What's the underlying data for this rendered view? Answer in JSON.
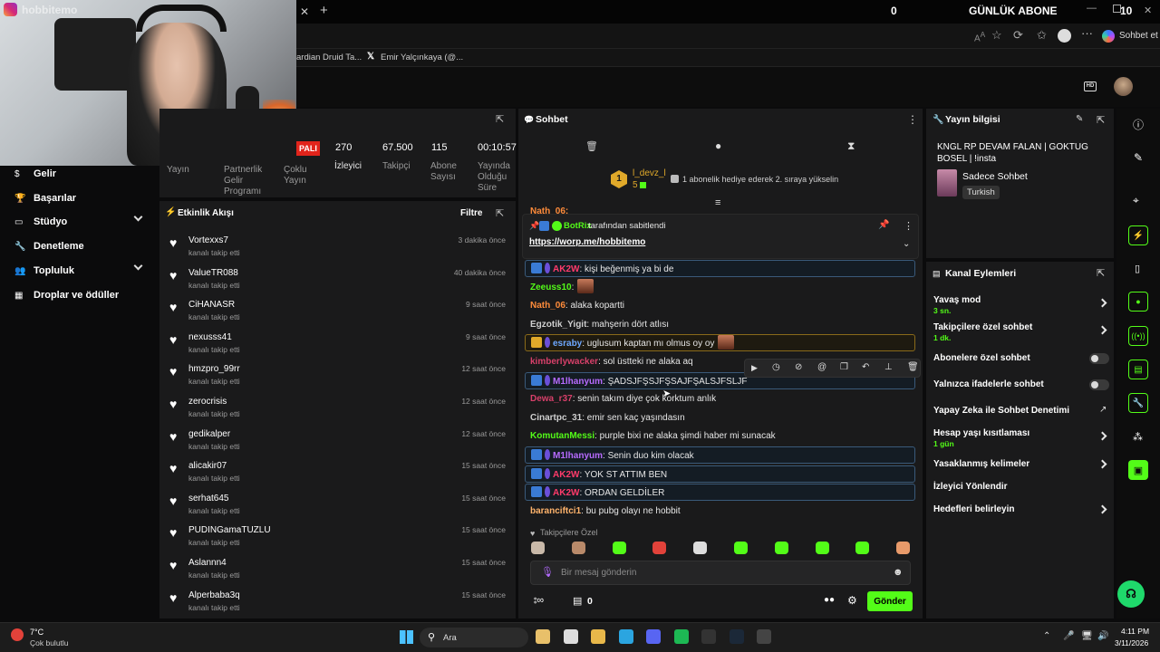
{
  "browser": {
    "webcam_overlay_text": "hobbitemo",
    "counter_left": "0",
    "daily_label": "GÜNLÜK ABONE",
    "counter_right": "10",
    "bookmark_1": "ardian Druid Ta...",
    "bookmark_2": "Emir Yalçınkaya (@...",
    "sohbet_et": "Sohbet et"
  },
  "stats": {
    "live_badge": "PALI",
    "viewers_value": "270",
    "viewers_label": "İzleyici",
    "followers_value": "67.500",
    "followers_label": "Takipçi",
    "subs_value": "115",
    "subs_label": "Abone Sayısı",
    "duration_value": "00:10:57",
    "duration_label": "Yayında Olduğu Süre",
    "col1": "Yayın",
    "col2": "Partnerlik Gelir Programı",
    "col3": "Çoklu Yayın"
  },
  "sidebar": {
    "items": [
      {
        "label": "Gelir",
        "chevron": false
      },
      {
        "label": "Başarılar",
        "chevron": false
      },
      {
        "label": "Stüdyo",
        "chevron": true
      },
      {
        "label": "Denetleme",
        "chevron": false
      },
      {
        "label": "Topluluk",
        "chevron": true
      },
      {
        "label": "Droplar ve ödüller",
        "chevron": false
      }
    ]
  },
  "activity": {
    "title": "Etkinlik Akışı",
    "filter": "Filtre",
    "action_text": "kanalı takip etti",
    "rows": [
      {
        "name": "Vortexxs7",
        "time": "3 dakika önce"
      },
      {
        "name": "ValueTR088",
        "time": "40 dakika önce"
      },
      {
        "name": "CiHANASR",
        "time": "9 saat önce"
      },
      {
        "name": "nexusss41",
        "time": "9 saat önce"
      },
      {
        "name": "hmzpro_99rr",
        "time": "12 saat önce"
      },
      {
        "name": "zerocrisis",
        "time": "12 saat önce"
      },
      {
        "name": "gedikalper",
        "time": "12 saat önce"
      },
      {
        "name": "alicakir07",
        "time": "15 saat önce"
      },
      {
        "name": "serhat645",
        "time": "15 saat önce"
      },
      {
        "name": "PUDINGamaTUZLU",
        "time": "15 saat önce"
      },
      {
        "name": "Aslannn4",
        "time": "15 saat önce"
      },
      {
        "name": "Alperbaba3q",
        "time": "15 saat önce"
      }
    ]
  },
  "chat": {
    "title": "Sohbet",
    "gift_user": "l_devz_l",
    "gift_level": "5",
    "gift_text": "1 abonelik hediye ederek 2. sıraya yükselin",
    "clipped_user": "Nath_06:",
    "pinned_by": "BotRix",
    "pinned_suffix": "tarafından sabitlendi",
    "pinned_link": "https://worp.me/hobbitemo",
    "messages": [
      {
        "user": "AK2W",
        "text": ": kişi beğenmiş ya bi de",
        "color": "#ff3b6b",
        "style": "boxed"
      },
      {
        "user": "Zeeuss10",
        "text": ":",
        "color": "#53fc18",
        "style": "plain"
      },
      {
        "user": "Nath_06",
        "text": ": alaka kopartti",
        "color": "#ff8c3b",
        "style": "plain"
      },
      {
        "user": "Egzotik_Yigit",
        "text": ": mahşerin dört atlısı",
        "color": "#cfcfcf",
        "style": "plain"
      },
      {
        "user": "esraby",
        "text": ": uglusum kaptan mı olmus oy oy",
        "color": "#6ea8ff",
        "style": "gold"
      },
      {
        "user": "kimberlywacker",
        "text": ": sol üstteki ne alaka aq",
        "color": "#d8406a",
        "style": "plain"
      },
      {
        "user": "M1lhanyum",
        "text": ": ŞADSJFŞSJFŞSAJFŞALSJFSLJF",
        "color": "#b76bff",
        "style": "boxed"
      },
      {
        "user": "Dewa_r37",
        "text": ": senin takım diye çok korktum anlık",
        "color": "#d8406a",
        "style": "plain"
      },
      {
        "user": "Cinartpc_31",
        "text": ": emir sen kaç yaşındasın",
        "color": "#cfcfcf",
        "style": "plain"
      },
      {
        "user": "KomutanMessi",
        "text": ": purple bixi ne alaka şimdi haber mi sunacak",
        "color": "#53fc18",
        "style": "plain"
      },
      {
        "user": "M1lhanyum",
        "text": ": Senin duo kim olacak",
        "color": "#b76bff",
        "style": "boxed"
      },
      {
        "user": "AK2W",
        "text": ": YOK ST ATTIM BEN",
        "color": "#ff3b6b",
        "style": "boxed"
      },
      {
        "user": "AK2W",
        "text": ": ORDAN GELDİLER",
        "color": "#ff3b6b",
        "style": "boxed"
      },
      {
        "user": "baranciftci1",
        "text": ": bu pubg olayı ne hobbit",
        "color": "#ffb36b",
        "style": "plain"
      }
    ],
    "followers_only": "Takipçilere Özel",
    "input_placeholder": "Bir mesaj gönderin",
    "points": "0",
    "send": "Gönder"
  },
  "stream_info": {
    "title": "Yayın bilgisi",
    "stream_title": "KNGL RP DEVAM FALAN | GOKTUG BOSEL | !insta",
    "category": "Sadece Sohbet",
    "language": "Turkish"
  },
  "channel_actions": {
    "title": "Kanal Eylemleri",
    "items": [
      {
        "label": "Yavaş mod",
        "sub": "3 sn.",
        "control": "chevron"
      },
      {
        "label": "Takipçilere özel sohbet",
        "sub": "1 dk.",
        "control": "chevron"
      },
      {
        "label": "Abonelere özel sohbet",
        "sub": "",
        "control": "toggle"
      },
      {
        "label": "Yalnızca ifadelerle sohbet",
        "sub": "",
        "control": "toggle"
      },
      {
        "label": "Yapay Zeka ile Sohbet Denetimi",
        "sub": "",
        "control": "external"
      },
      {
        "label": "Hesap yaşı kısıtlaması",
        "sub": "1 gün",
        "control": "chevron"
      },
      {
        "label": "Yasaklanmış kelimeler",
        "sub": "",
        "control": "chevron"
      },
      {
        "label": "İzleyici Yönlendir",
        "sub": "",
        "control": "none"
      },
      {
        "label": "Hedefleri belirleyin",
        "sub": "",
        "control": "chevron"
      }
    ]
  },
  "taskbar": {
    "temp": "7°C",
    "weather": "Çok bulutlu",
    "search": "Ara",
    "time": "4:11 PM",
    "date": "3/11/2026"
  },
  "colors": {
    "accent": "#53fc18",
    "panel": "#1a1a1b",
    "page": "#0b0b0c"
  }
}
